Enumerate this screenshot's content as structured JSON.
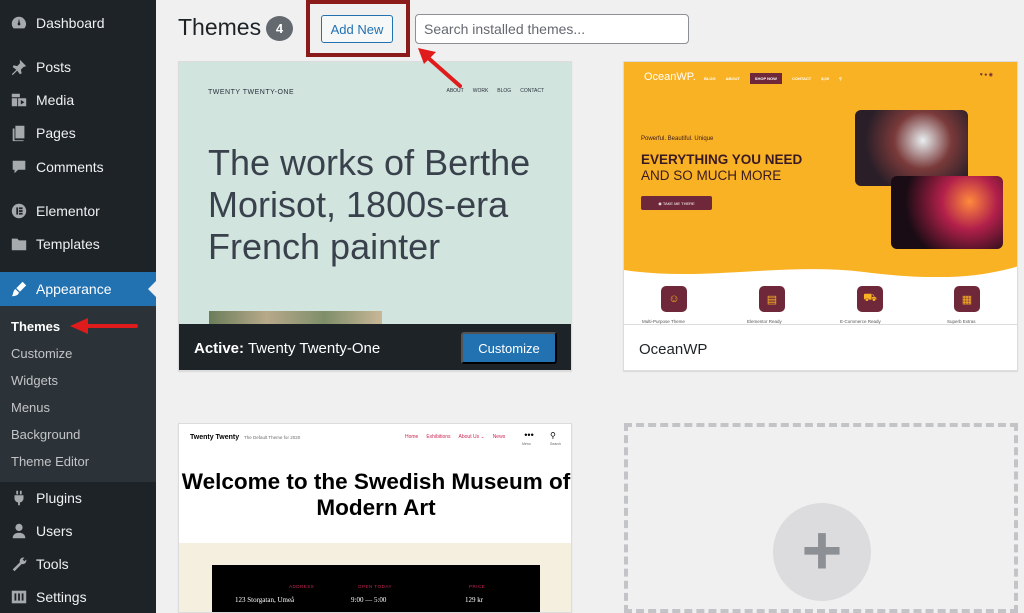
{
  "sidebar": {
    "items": [
      {
        "label": "Dashboard",
        "icon": "dashboard-icon"
      },
      {
        "label": "Posts",
        "icon": "pin-icon"
      },
      {
        "label": "Media",
        "icon": "media-icon"
      },
      {
        "label": "Pages",
        "icon": "pages-icon"
      },
      {
        "label": "Comments",
        "icon": "comments-icon"
      },
      {
        "label": "Elementor",
        "icon": "elementor-icon"
      },
      {
        "label": "Templates",
        "icon": "folder-icon"
      },
      {
        "label": "Appearance",
        "icon": "brush-icon"
      },
      {
        "label": "Plugins",
        "icon": "plugin-icon"
      },
      {
        "label": "Users",
        "icon": "users-icon"
      },
      {
        "label": "Tools",
        "icon": "wrench-icon"
      },
      {
        "label": "Settings",
        "icon": "settings-icon"
      }
    ],
    "active_item": "Appearance",
    "submenu": [
      "Themes",
      "Customize",
      "Widgets",
      "Menus",
      "Background",
      "Theme Editor"
    ],
    "current_submenu": "Themes"
  },
  "header": {
    "title": "Themes",
    "count": "4",
    "add_new_label": "Add New",
    "search_placeholder": "Search installed themes..."
  },
  "themes": {
    "twenty_twenty_one": {
      "preview_site_title": "TWENTY TWENTY-ONE",
      "preview_nav": [
        "ABOUT",
        "WORK",
        "BLOG",
        "CONTACT"
      ],
      "preview_hero": "The works of Berthe Morisot, 1800s-era French painter",
      "active_prefix": "Active:",
      "name": "Twenty Twenty-One",
      "customize_label": "Customize"
    },
    "oceanwp": {
      "preview_logo": "OceanWP.",
      "preview_nav": [
        "BLOG",
        "ABOUT",
        "SHOP NOW",
        "CONTACT",
        "$,00"
      ],
      "preview_social": "♥ ● ◉",
      "preview_tagline": "Powerful. Beautiful. Unique",
      "preview_heading": "EVERYTHING YOU NEED",
      "preview_subheading": "AND SO MUCH MORE",
      "preview_button": "◉ TAKE ME THERE",
      "preview_features": [
        "Multi-Purpose Theme",
        "Elementor Ready",
        "E-Commerce Ready",
        "Superb Extras"
      ],
      "name": "OceanWP"
    },
    "twenty_twenty": {
      "preview_site_title": "Twenty Twenty",
      "preview_description": "The Default Theme for 2020",
      "preview_nav": [
        "Home",
        "Exhibitions",
        "About Us ⌄",
        "News"
      ],
      "preview_menu_label": "Menu",
      "preview_search_label": "Search",
      "preview_heading": "Welcome to the Swedish Museum of Modern Art",
      "preview_columns": [
        {
          "heading": "ADDRESS",
          "value": "123 Storgatan, Umeå"
        },
        {
          "heading": "OPEN TODAY",
          "value": "9:00 — 5:00"
        },
        {
          "heading": "PRICE",
          "value": "129 kr"
        }
      ]
    }
  },
  "colors": {
    "sidebar_bg": "#1d2327",
    "accent": "#2271b1",
    "annotation_red": "#e01b1b",
    "highlight_box": "#8b1a1a"
  }
}
